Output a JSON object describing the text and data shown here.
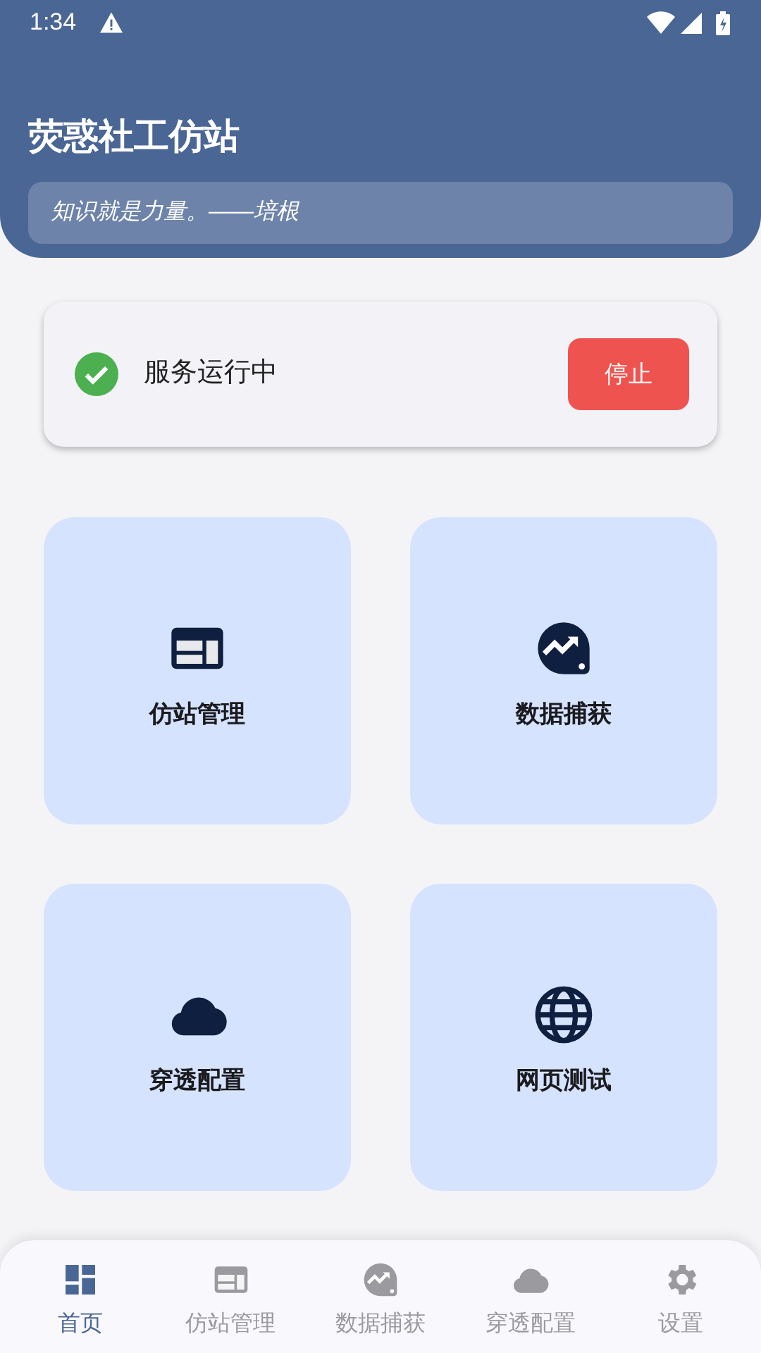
{
  "status_bar": {
    "time": "1:34"
  },
  "header": {
    "title": "荧惑社工仿站",
    "quote": "知识就是力量。——培根"
  },
  "service": {
    "running": true,
    "label": "服务运行中",
    "button": "停止"
  },
  "tiles": [
    {
      "kind": "web",
      "label": "仿站管理"
    },
    {
      "kind": "analytics",
      "label": "数据捕获"
    },
    {
      "kind": "cloud",
      "label": "穿透配置"
    },
    {
      "kind": "globe",
      "label": "网页测试"
    }
  ],
  "bottom_nav": [
    {
      "kind": "dashboard",
      "label": "首页",
      "selected": true
    },
    {
      "kind": "web",
      "label": "仿站管理",
      "selected": false
    },
    {
      "kind": "analytics",
      "label": "数据捕获",
      "selected": false
    },
    {
      "kind": "cloud",
      "label": "穿透配置",
      "selected": false
    },
    {
      "kind": "gear",
      "label": "设置",
      "selected": false
    }
  ]
}
